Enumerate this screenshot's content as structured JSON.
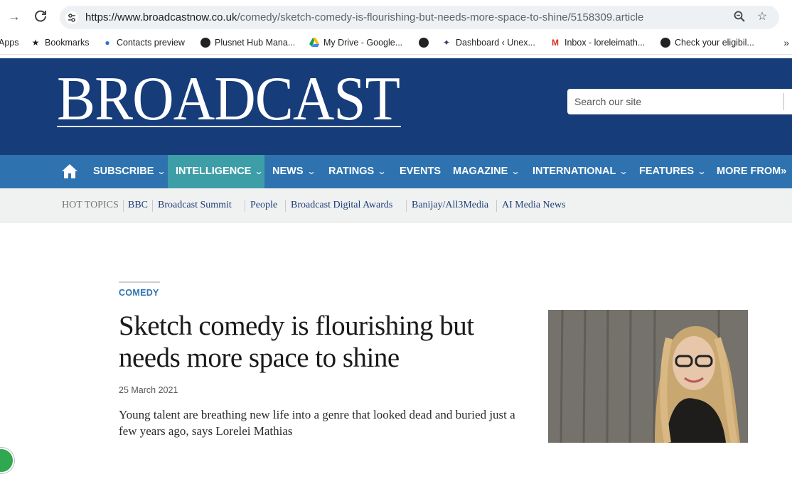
{
  "browser": {
    "url_host": "https://www.broadcastnow.co.uk",
    "url_path": "/comedy/sketch-comedy-is-flourishing-but-needs-more-space-to-shine/5158309.article",
    "bookmarks": [
      {
        "label": "Apps",
        "icon": "apps-grid-icon"
      },
      {
        "label": "Bookmarks",
        "icon": "star-icon"
      },
      {
        "label": "Contacts preview",
        "icon": "contacts-person-icon"
      },
      {
        "label": "Plusnet Hub Mana...",
        "icon": "globe-icon"
      },
      {
        "label": "My Drive - Google...",
        "icon": "google-drive-icon"
      },
      {
        "label": "",
        "icon": "globe-icon"
      },
      {
        "label": "Dashboard ‹ Unex...",
        "icon": "wordpress-icon"
      },
      {
        "label": "Inbox - loreleimath...",
        "icon": "gmail-icon"
      },
      {
        "label": "Check your eligibil...",
        "icon": "globe-icon"
      }
    ],
    "more_bookmarks": "»"
  },
  "site": {
    "logo": "BROADCAST",
    "search_placeholder": "Search our site",
    "brand_color": "#163c7a",
    "nav_color": "#2e73b0",
    "nav_active_color": "#3e9ea7"
  },
  "nav": {
    "items": [
      {
        "label": "SUBSCRIBE",
        "dropdown": true
      },
      {
        "label": "INTELLIGENCE",
        "dropdown": true,
        "active": true
      },
      {
        "label": "NEWS",
        "dropdown": true
      },
      {
        "label": "RATINGS",
        "dropdown": true
      },
      {
        "label": "EVENTS",
        "dropdown": false
      },
      {
        "label": "MAGAZINE",
        "dropdown": true
      },
      {
        "label": "INTERNATIONAL",
        "dropdown": true
      },
      {
        "label": "FEATURES",
        "dropdown": true
      },
      {
        "label": "MORE FROM",
        "dropdown": false
      }
    ],
    "more_glyph": "»"
  },
  "hot_topics": {
    "label": "HOT TOPICS",
    "items": [
      "BBC",
      "Broadcast Summit",
      "People",
      "Broadcast Digital Awards",
      "Banijay/All3Media",
      "AI Media News"
    ]
  },
  "article": {
    "category": "COMEDY",
    "headline": "Sketch comedy is flourishing but needs more space to shine",
    "date": "25 March 2021",
    "standfirst": "Young talent are breathing new life into a genre that looked dead and buried just a few years ago, says Lorelei Mathias"
  }
}
